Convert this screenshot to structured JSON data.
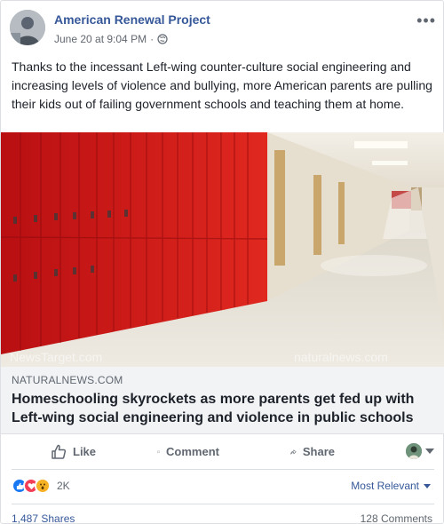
{
  "post": {
    "page_name": "American Renewal Project",
    "timestamp": "June 20 at 9:04 PM",
    "separator": "·",
    "globe_icon": "globe-icon",
    "more_label": "•••",
    "text": "Thanks to the incessant Left-wing counter-culture social engineering and increasing levels of violence and bullying, more American parents are pulling their kids out of failing government schools and teaching them at home."
  },
  "link": {
    "domain": "NATURALNEWS.COM",
    "title": "Homeschooling skyrockets as more parents get fed up with Left-wing social engineering and violence in public schools",
    "watermark_left": "NewsTarget.com",
    "watermark_right": "naturalnews.com"
  },
  "actions": {
    "like": "Like",
    "comment": "Comment",
    "share": "Share"
  },
  "reactions": {
    "count": "2K",
    "sort_label": "Most Relevant",
    "icons": [
      "like-reaction-icon",
      "love-reaction-icon",
      "wow-reaction-icon"
    ]
  },
  "footer": {
    "shares": "1,487 Shares",
    "comments": "128 Comments"
  },
  "colors": {
    "link_blue": "#365899",
    "lockers_red": "#d21d1d",
    "like_blue": "#1877f2",
    "love_red": "#f33e58",
    "wow_yellow": "#f7b125"
  }
}
